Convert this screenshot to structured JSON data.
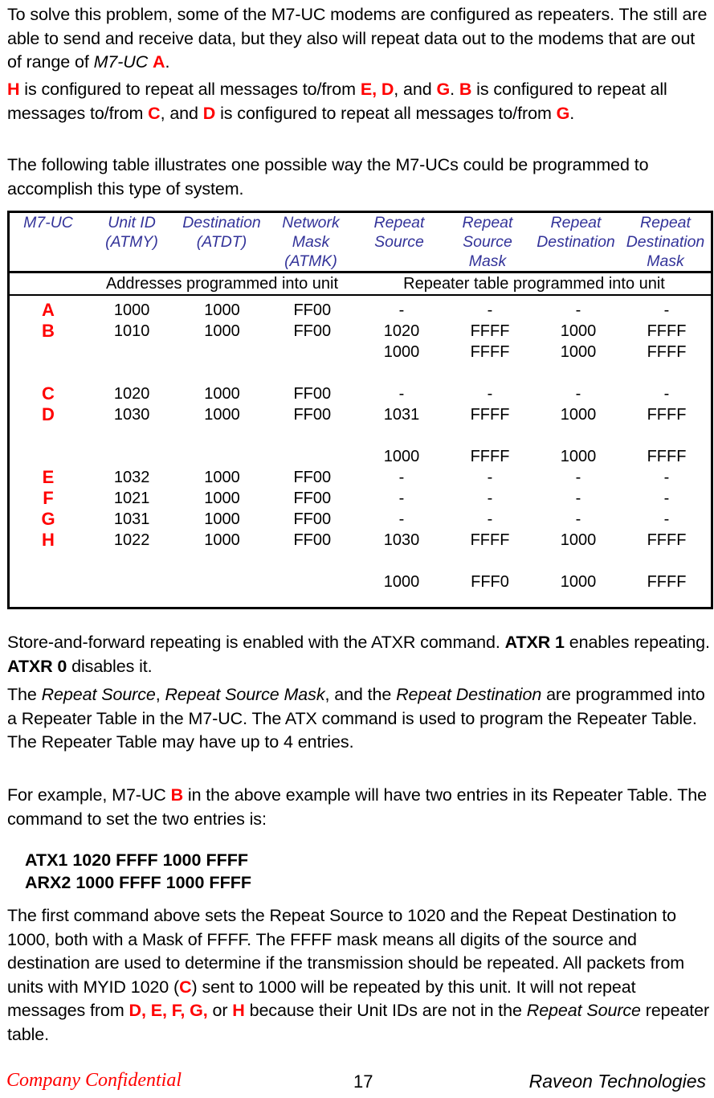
{
  "paragraphs": {
    "p1": {
      "line1": "To solve this problem, some of the M7-UC modems are configured as",
      "line2": "repeaters.  The still are able to send and receive data, but they also will",
      "line3_a": "repeat data out to the modems that are out of range of ",
      "line3_ital": "M7-UC",
      "line3_red": "A",
      "line3_end": "."
    },
    "p2": {
      "s1_red": "H",
      "s1": " is configured to repeat all messages to/from ",
      "s2_red": "E, D",
      "s2": ", and ",
      "s3_red": "G",
      "s3": ".  ",
      "s4_red": "B",
      "s4": " is configured to repeat all messages to/from ",
      "s5_red": "C",
      "s5": ", and ",
      "s6_red": "D",
      "s6": " is configured to repeat all messages to/from ",
      "s7_red": "G",
      "s7": "."
    },
    "p3": {
      "line1": "The following table illustrates one possible way the M7-UCs could be",
      "line2": "programmed to accomplish this type of system."
    },
    "p4": {
      "s1": "Store-and-forward repeating is enabled with the ATXR command.  ",
      "s2_bold": "ATXR 1",
      "s3": " enables repeating. ",
      "s4_bold": "ATXR 0",
      "s5": " disables it."
    },
    "p5": {
      "s1": "The ",
      "s2_ital": "Repeat Source",
      "s3": ", ",
      "s4_ital": "Repeat Source Mask",
      "s5": ", and the ",
      "s6_ital": "Repeat Destination",
      "s7": " are programmed into a Repeater Table in the M7-UC.  The ATX command is used to program the Repeater Table.  The Repeater Table may have up to 4 entries."
    },
    "p6": {
      "s1": "For example, M7-UC ",
      "s2_red": "B",
      "s3": " in the above example will have two entries in its Repeater Table.  The command to set the two entries is:"
    },
    "p7": {
      "s1": "The first command above sets the Repeat Source to 1020 and the Repeat Destination to 1000, both with a Mask of FFFF.  The FFFF mask means all digits of the source and destination are used to determine if the transmission should be repeated. All packets from units with MYID 1020 (",
      "s2_red": "C",
      "s3": ") sent to 1000 will be repeated by this unit.  It will not repeat messages from ",
      "s4_red": "D, E, F, G,",
      "s5": " or ",
      "s6_red": "H",
      "s7": " because their Unit IDs are not in the ",
      "s8_ital": "Repeat Source",
      "s9": " repeater table."
    }
  },
  "commands": {
    "line1": "ATX1 1020 FFFF 1000 FFFF",
    "line2": "ARX2 1000 FFFF 1000 FFFF"
  },
  "table": {
    "headers": {
      "c0": "M7-UC",
      "c1_l1": "Unit ID",
      "c1_l2": "(ATMY)",
      "c2_l1": "Destination",
      "c2_l2": "(ATDT)",
      "c3_l1": "Network",
      "c3_l2": "Mask",
      "c3_l3": "(ATMK)",
      "c4_l1": "Repeat",
      "c4_l2": "Source",
      "c5_l1": "Repeat",
      "c5_l2": "Source",
      "c5_l3": "Mask",
      "c6_l1": "Repeat",
      "c6_l2": "Destination",
      "c7_l1": "Repeat",
      "c7_l2": "Destination",
      "c7_l3": "Mask"
    },
    "group_headers": {
      "left": "Addresses programmed into unit",
      "right": "Repeater table programmed into unit"
    },
    "rows": [
      {
        "letter": "A",
        "unit_id": "1000",
        "destination": "1000",
        "network_mask": "FF00",
        "repeat_entries": [
          {
            "source": "-",
            "source_mask": "-",
            "destination": "-",
            "destination_mask": "-"
          }
        ]
      },
      {
        "letter": "B",
        "unit_id": "1010",
        "destination": "1000",
        "network_mask": "FF00",
        "repeat_entries": [
          {
            "source": "1020",
            "source_mask": "FFFF",
            "destination": "1000",
            "destination_mask": "FFFF"
          },
          {
            "source": "1000",
            "source_mask": "FFFF",
            "destination": "1000",
            "destination_mask": "FFFF"
          }
        ]
      },
      {
        "letter": "C",
        "unit_id": "1020",
        "destination": "1000",
        "network_mask": "FF00",
        "repeat_entries": [
          {
            "source": "-",
            "source_mask": "-",
            "destination": "-",
            "destination_mask": "-"
          }
        ]
      },
      {
        "letter": "D",
        "unit_id": "1030",
        "destination": "1000",
        "network_mask": "FF00",
        "repeat_entries": [
          {
            "source": "1031",
            "source_mask": "FFFF",
            "destination": "1000",
            "destination_mask": "FFFF"
          },
          {
            "source": "1000",
            "source_mask": "FFFF",
            "destination": "1000",
            "destination_mask": "FFFF"
          }
        ]
      },
      {
        "letter": "E",
        "unit_id": "1032",
        "destination": "1000",
        "network_mask": "FF00",
        "repeat_entries": [
          {
            "source": "-",
            "source_mask": "-",
            "destination": "-",
            "destination_mask": "-"
          }
        ]
      },
      {
        "letter": "F",
        "unit_id": "1021",
        "destination": "1000",
        "network_mask": "FF00",
        "repeat_entries": [
          {
            "source": "-",
            "source_mask": "-",
            "destination": "-",
            "destination_mask": "-"
          }
        ]
      },
      {
        "letter": "G",
        "unit_id": "1031",
        "destination": "1000",
        "network_mask": "FF00",
        "repeat_entries": [
          {
            "source": "-",
            "source_mask": "-",
            "destination": "-",
            "destination_mask": "-"
          }
        ]
      },
      {
        "letter": "H",
        "unit_id": "1022",
        "destination": "1000",
        "network_mask": "FF00",
        "repeat_entries": [
          {
            "source": "1030",
            "source_mask": "FFFF",
            "destination": "1000",
            "destination_mask": "FFFF"
          },
          {
            "source": "1000",
            "source_mask": "FFF0",
            "destination": "1000",
            "destination_mask": "FFFF"
          }
        ]
      }
    ]
  },
  "footer": {
    "left": "Company Confidential",
    "page_number": "17",
    "right": "Raveon Technologies"
  },
  "colors": {
    "accent_red": "#FF0000",
    "header_blue": "#333399",
    "text": "#000000"
  }
}
